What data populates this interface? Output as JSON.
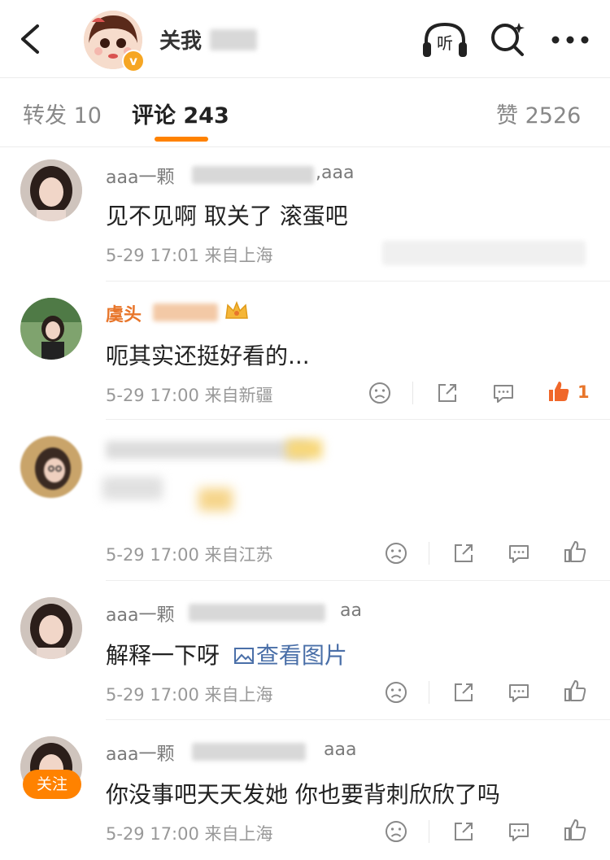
{
  "header": {
    "title": "关我",
    "verified_badge": "v",
    "icons": [
      "back-icon",
      "listen-icon",
      "search-icon",
      "more-icon"
    ],
    "listen_label": "听"
  },
  "tabs": {
    "repost": "转发 10",
    "comments": "评论 243",
    "likes": "赞 2526"
  },
  "comments": [
    {
      "name": "aaa一颗",
      "name_suffix": ",aaa",
      "text": "见不见啊  取关了  滚蛋吧",
      "meta": "5-29 17:01  来自上海"
    },
    {
      "name": "虞头",
      "text": "呃其实还挺好看的...",
      "meta": "5-29 17:00  来自新疆",
      "like_count": "1"
    },
    {
      "name": "",
      "text": "",
      "meta": "5-29 17:00  来自江苏"
    },
    {
      "name": "aaa一颗",
      "name_suffix": "aa",
      "text": "解释一下呀",
      "link": "查看图片",
      "meta": "5-29 17:00  来自上海"
    },
    {
      "name": "aaa一颗",
      "name_suffix": "aaa",
      "text": "你没事吧天天发她  你也要背刺欣欣了吗",
      "meta": "5-29 17:00  来自上海",
      "follow_label": "关注"
    }
  ],
  "colors": {
    "accent": "#ff8200",
    "link": "#4a6fa8",
    "gold_name": "#e8762b"
  }
}
